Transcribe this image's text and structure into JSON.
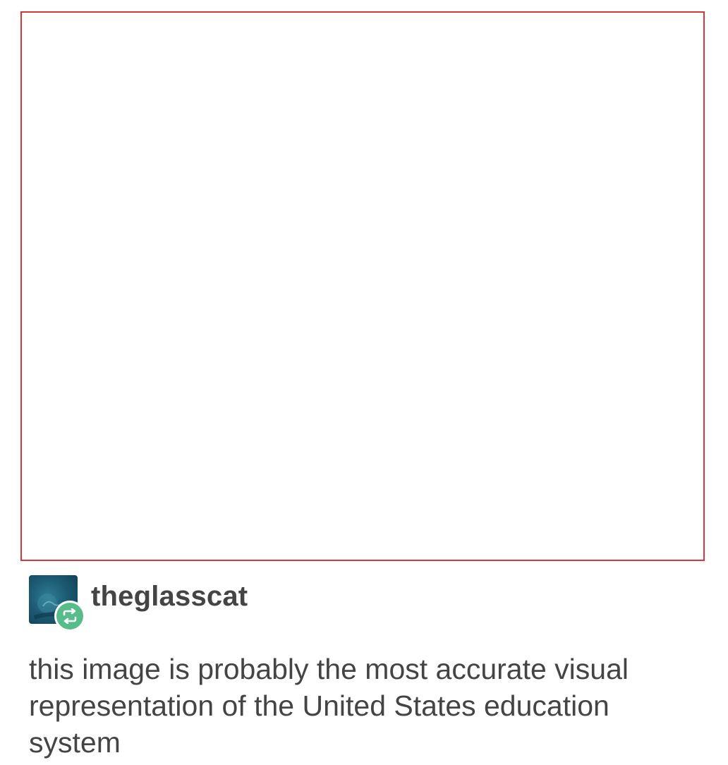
{
  "post": {
    "image": {
      "border_color": "#d9363a"
    },
    "author": {
      "username": "theglasscat",
      "avatar_icon": "avatar-icon",
      "badge_icon": "reblog-icon",
      "badge_color": "#56bc8a"
    },
    "body_text": "this image is probably the most accurate visual representation of the United States education system"
  }
}
